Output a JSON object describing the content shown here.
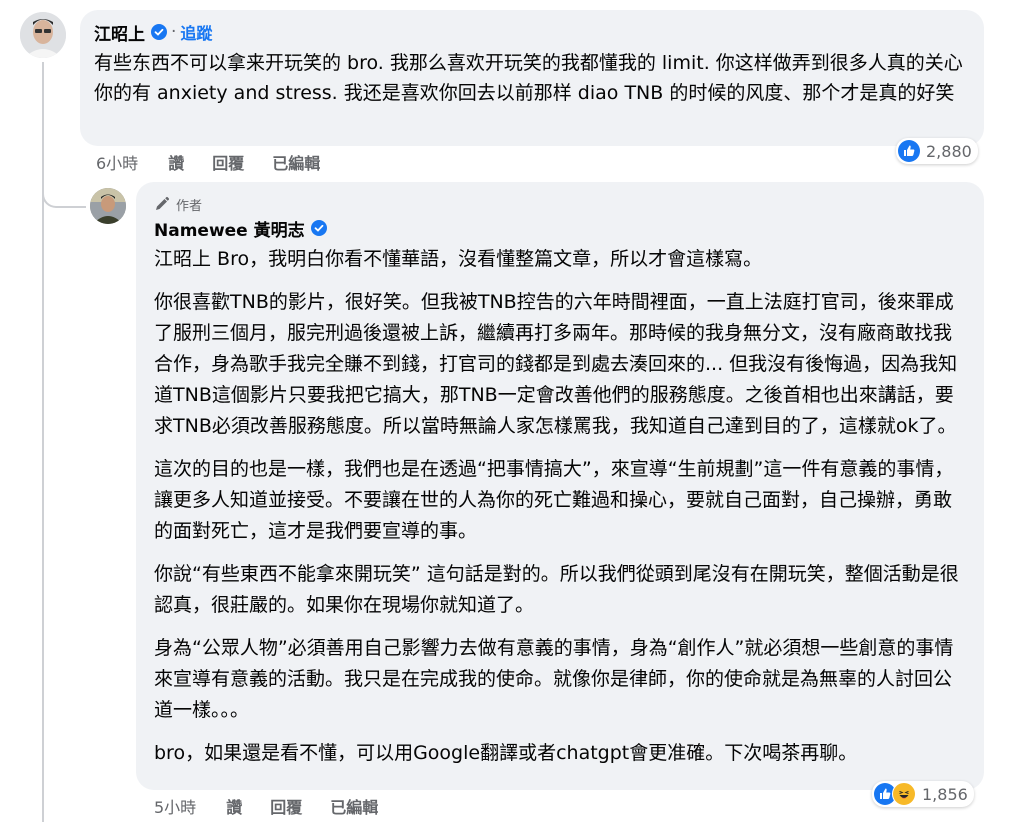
{
  "comment1": {
    "author": "江昭上",
    "follow": "追蹤",
    "text": "有些东西不可以拿来开玩笑的 bro. 我那么喜欢开玩笑的我都懂我的 limit. 你这样做弄到很多人真的关心你的有 anxiety and stress. 我还是喜欢你回去以前那样 diao TNB 的时候的风度、那个才是真的好笑",
    "time": "6小時",
    "like_label": "讚",
    "reply_label": "回覆",
    "edited_label": "已編輯",
    "reaction_count": "2,880"
  },
  "reply": {
    "badge": "作者",
    "author": "Namewee 黃明志",
    "paragraphs": [
      "江昭上 Bro，我明白你看不懂華語，沒看懂整篇文章，所以才會這樣寫。",
      "你很喜歡TNB的影片，很好笑。但我被TNB控告的六年時間裡面，一直上法庭打官司，後來罪成了服刑三個月，服完刑過後還被上訴，繼續再打多兩年。那時候的我身無分文，沒有廠商敢找我合作，身為歌手我完全賺不到錢，打官司的錢都是到處去湊回來的... 但我沒有後悔過，因為我知道TNB這個影片只要我把它搞大，那TNB一定會改善他們的服務態度。之後首相也出來講話，要求TNB必須改善服務態度。所以當時無論人家怎樣罵我，我知道自己達到目的了，這樣就ok了。",
      "這次的目的也是一樣，我們也是在透過“把事情搞大”，來宣導“生前規劃”這一件有意義的事情，讓更多人知道並接受。不要讓在世的人為你的死亡難過和操心，要就自己面對，自己操辦，勇敢的面對死亡，這才是我們要宣導的事。",
      "你說“有些東西不能拿來開玩笑” 這句話是對的。所以我們從頭到尾沒有在開玩笑，整個活動是很認真，很莊嚴的。如果你在現場你就知道了。",
      "身為“公眾人物”必須善用自己影響力去做有意義的事情，身為“創作人”就必須想一些創意的事情來宣導有意義的活動。我只是在完成我的使命。就像你是律師，你的使命就是為無辜的人討回公道一樣。。。",
      "bro，如果還是看不懂，可以用Google翻譯或者chatgpt會更准確。下次喝茶再聊。"
    ],
    "time": "5小時",
    "like_label": "讚",
    "reply_label": "回覆",
    "edited_label": "已編輯",
    "reaction_count": "1,856"
  },
  "colors": {
    "accent": "#1877f2",
    "bubble": "#f0f2f5",
    "muted": "#65676b"
  },
  "icons": [
    "verified-badge-icon",
    "pen-icon",
    "like-reaction-icon",
    "haha-reaction-icon"
  ]
}
